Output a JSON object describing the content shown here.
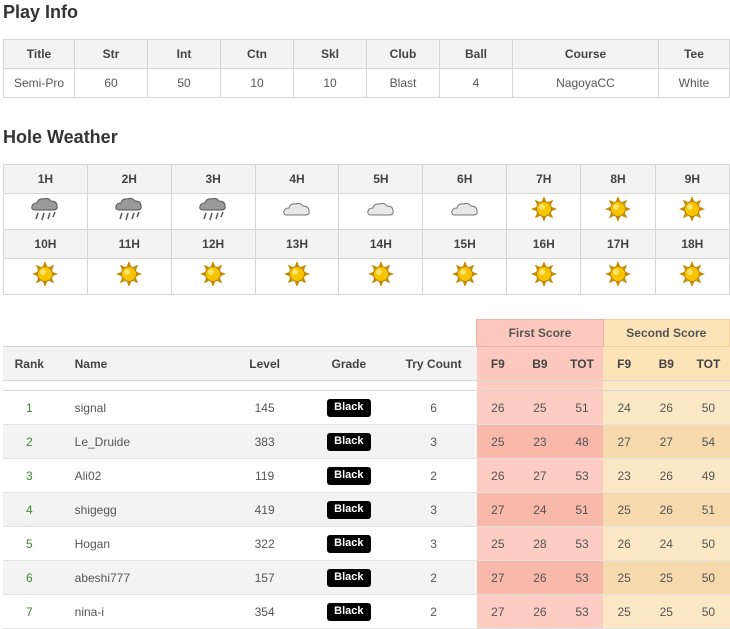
{
  "play_info": {
    "heading": "Play Info",
    "headers": [
      "Title",
      "Str",
      "Int",
      "Ctn",
      "Skl",
      "Club",
      "Ball",
      "Course",
      "Tee"
    ],
    "values": [
      "Semi-Pro",
      "60",
      "50",
      "10",
      "10",
      "Blast",
      "4",
      "NagoyaCC",
      "White"
    ]
  },
  "weather": {
    "heading": "Hole Weather",
    "rows": [
      {
        "holes": [
          "1H",
          "2H",
          "3H",
          "4H",
          "5H",
          "6H",
          "7H",
          "8H",
          "9H"
        ],
        "icons": [
          "rain-cloud-icon",
          "rain-cloud-icon",
          "rain-cloud-icon",
          "cloud-icon",
          "cloud-icon",
          "cloud-icon",
          "sun-icon",
          "sun-icon",
          "sun-icon"
        ]
      },
      {
        "holes": [
          "10H",
          "11H",
          "12H",
          "13H",
          "14H",
          "15H",
          "16H",
          "17H",
          "18H"
        ],
        "icons": [
          "sun-icon",
          "sun-icon",
          "sun-icon",
          "sun-icon",
          "sun-icon",
          "sun-icon",
          "sun-icon",
          "sun-icon",
          "sun-icon"
        ]
      }
    ]
  },
  "ranking": {
    "group_headers": {
      "first": "First Score",
      "second": "Second Score"
    },
    "columns": {
      "rank": "Rank",
      "name": "Name",
      "level": "Level",
      "grade": "Grade",
      "try": "Try Count",
      "f9": "F9",
      "b9": "B9",
      "tot": "TOT"
    },
    "rows": [
      {
        "rank": "1",
        "name": "signal",
        "level": "145",
        "grade": "Black",
        "try": "6",
        "first": [
          "26",
          "25",
          "51"
        ],
        "second": [
          "24",
          "26",
          "50"
        ]
      },
      {
        "rank": "2",
        "name": "Le_Druide",
        "level": "383",
        "grade": "Black",
        "try": "3",
        "first": [
          "25",
          "23",
          "48"
        ],
        "second": [
          "27",
          "27",
          "54"
        ]
      },
      {
        "rank": "3",
        "name": "Ali02",
        "level": "119",
        "grade": "Black",
        "try": "2",
        "first": [
          "26",
          "27",
          "53"
        ],
        "second": [
          "23",
          "26",
          "49"
        ]
      },
      {
        "rank": "4",
        "name": "shigegg",
        "level": "419",
        "grade": "Black",
        "try": "3",
        "first": [
          "27",
          "24",
          "51"
        ],
        "second": [
          "25",
          "26",
          "51"
        ]
      },
      {
        "rank": "5",
        "name": "Hogan",
        "level": "322",
        "grade": "Black",
        "try": "3",
        "first": [
          "25",
          "28",
          "53"
        ],
        "second": [
          "26",
          "24",
          "50"
        ]
      },
      {
        "rank": "6",
        "name": "abeshi777",
        "level": "157",
        "grade": "Black",
        "try": "2",
        "first": [
          "27",
          "26",
          "53"
        ],
        "second": [
          "25",
          "25",
          "50"
        ]
      },
      {
        "rank": "7",
        "name": "nina-i",
        "level": "354",
        "grade": "Black",
        "try": "2",
        "first": [
          "27",
          "26",
          "53"
        ],
        "second": [
          "25",
          "25",
          "50"
        ]
      }
    ]
  },
  "colors": {
    "first_score_bg": "#fdc8bd",
    "second_score_bg": "#fde3b8",
    "rank_text": "#3c8a2e",
    "grade_badge": "#000000"
  }
}
